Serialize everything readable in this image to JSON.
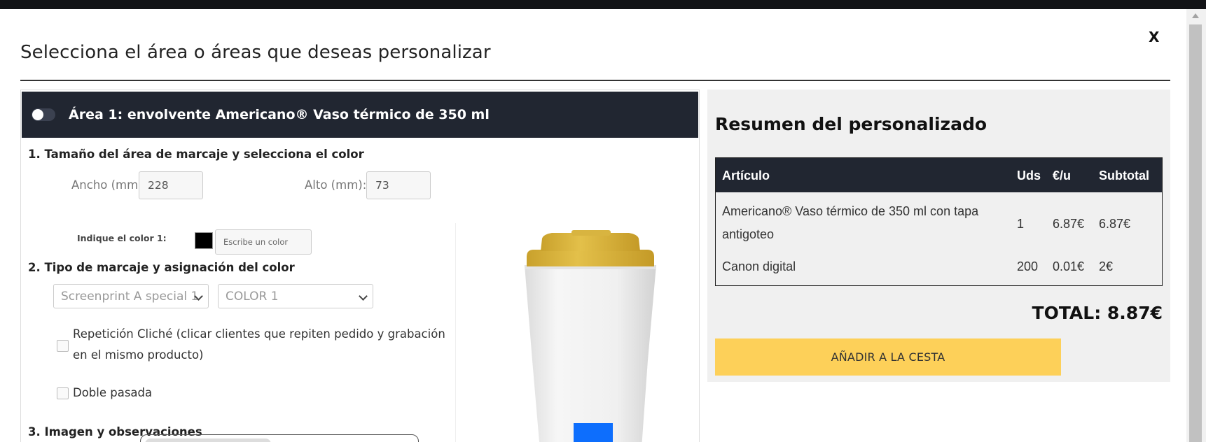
{
  "modal": {
    "title": "Selecciona el área o áreas que deseas personalizar",
    "close_label": "X"
  },
  "area": {
    "header": "Área 1: envolvente Americano® Vaso térmico de 350 ml",
    "toggle_on": false,
    "section1_title": "1. Tamaño del área de marcaje y selecciona el color",
    "width_label": "Ancho (mm):",
    "width_value": "228",
    "height_label": "Alto (mm):",
    "height_value": "73",
    "color_label": "Indique el color 1:",
    "color_swatch": "#000000",
    "color_placeholder": "Escribe un color",
    "section2_title": "2. Tipo de marcaje y asignación del color",
    "marking_select": "Screenprint A special 1",
    "color_select": "COLOR 1",
    "repeat_label": "Repetición Cliché (clicar clientes que repiten pedido y grabación en el mismo producto)",
    "repeat_checked": false,
    "double_label": "Doble pasada",
    "double_checked": false,
    "section3_title": "3. Imagen y observaciones"
  },
  "preview": {
    "lid_color": "#d9b33b",
    "body_color": "#efefef",
    "mark_color": "#0d6efd"
  },
  "summary": {
    "title": "Resumen del personalizado",
    "columns": [
      "Artículo",
      "Uds",
      "€/u",
      "Subtotal"
    ],
    "rows": [
      {
        "article": "Americano® Vaso térmico de 350 ml con tapa antigoteo",
        "units": "1",
        "unit_price": "6.87€",
        "subtotal": "6.87€"
      },
      {
        "article": "Canon digital",
        "units": "200",
        "unit_price": "0.01€",
        "subtotal": "2€"
      }
    ],
    "total": "TOTAL: 8.87€",
    "add_button": "AÑADIR A LA CESTA",
    "header_bg": "#212631",
    "button_bg": "#fdd059"
  }
}
